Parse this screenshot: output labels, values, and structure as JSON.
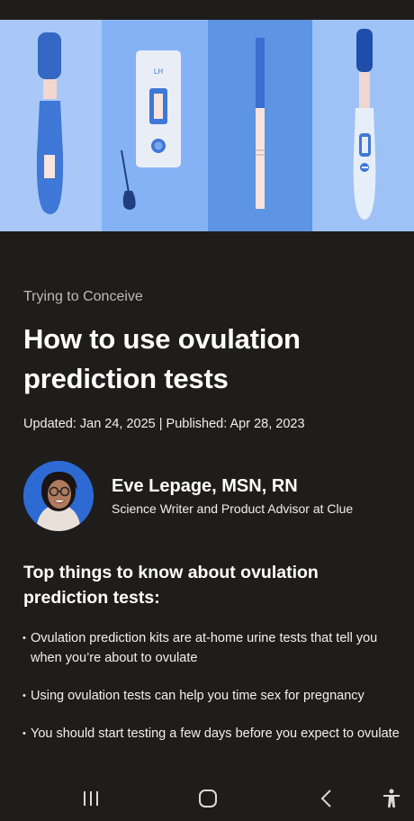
{
  "article": {
    "category": "Trying to Conceive",
    "title": "How to use ovulation prediction tests",
    "dates": "Updated: Jan 24, 2025 | Published: Apr 28, 2023"
  },
  "author": {
    "name": "Eve Lepage, MSN, RN",
    "role": "Science Writer and Product Advisor at Clue"
  },
  "section": {
    "title": "Top things to know about ovulation prediction tests:",
    "bullets": [
      "Ovulation prediction kits are at-home urine tests that tell you when you’re about to ovulate",
      "Using ovulation tests can help you time sex for pregnancy",
      "You should start testing a few days before you expect to ovulate"
    ]
  },
  "hero": {
    "cassette_label": "LH",
    "colors": [
      "#a9c8f7",
      "#85b2f4",
      "#5d94e3",
      "#9ec2f6"
    ]
  },
  "navbar": {
    "icons": [
      "recent-apps-icon",
      "home-icon",
      "back-icon",
      "accessibility-icon"
    ]
  }
}
